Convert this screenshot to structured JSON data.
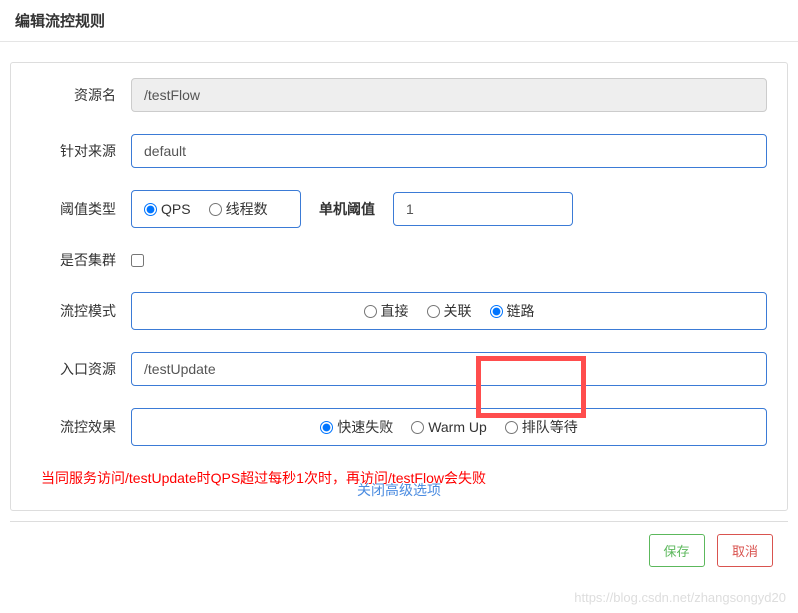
{
  "modal": {
    "title": "编辑流控规则"
  },
  "form": {
    "resourceName": {
      "label": "资源名",
      "value": "/testFlow"
    },
    "limitApp": {
      "label": "针对来源",
      "value": "default"
    },
    "thresholdType": {
      "label": "阈值类型",
      "qps": "QPS",
      "threads": "线程数"
    },
    "threshold": {
      "label": "单机阈值",
      "value": "1"
    },
    "cluster": {
      "label": "是否集群"
    },
    "flowMode": {
      "label": "流控模式",
      "direct": "直接",
      "relate": "关联",
      "chain": "链路"
    },
    "entryResource": {
      "label": "入口资源",
      "value": "/testUpdate"
    },
    "flowEffect": {
      "label": "流控效果",
      "fastFail": "快速失败",
      "warmUp": "Warm Up",
      "queue": "排队等待"
    }
  },
  "note": "当同服务访问/testUpdate时QPS超过每秒1次时，再访问/testFlow会失败",
  "toggleLink": "关闭高级选项",
  "footer": {
    "save": "保存",
    "cancel": "取消"
  },
  "watermark": "https://blog.csdn.net/zhangsongyd20"
}
